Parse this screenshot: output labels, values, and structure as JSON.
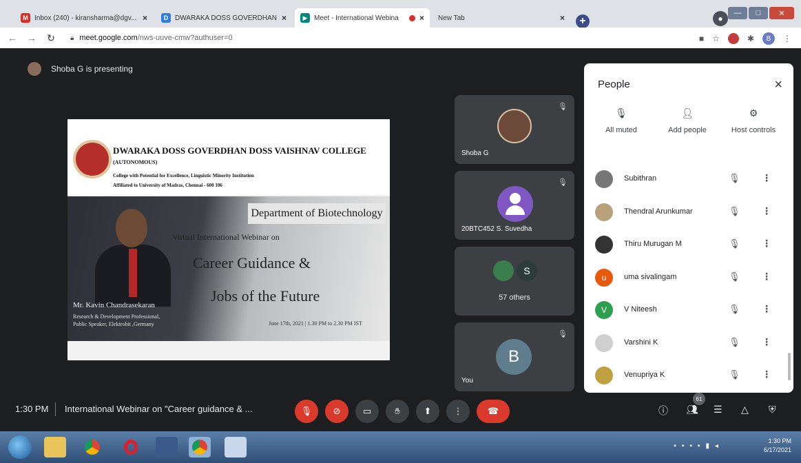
{
  "browser": {
    "tabs": [
      {
        "title": "Inbox (240) - kiransharma@dgv...",
        "close": "×",
        "favicon": "M",
        "favicon_color": "#d93025"
      },
      {
        "title": "DWARAKA DOSS GOVERDHAN D...",
        "close": "×",
        "favicon": "D",
        "favicon_color": "#2f7de1"
      },
      {
        "title": "Meet - International Webina",
        "close": "×",
        "favicon": "▶",
        "favicon_color": "#00897b"
      },
      {
        "title": "New Tab",
        "close": "×",
        "favicon": "",
        "favicon_color": ""
      }
    ],
    "new_tab": "+",
    "profile_letter": "",
    "url_host": "meet.google.com",
    "url_path": "/nws-uuve-cmw?authuser=0",
    "ext_letter": "B"
  },
  "meet": {
    "presenting_text": "Shoba G is presenting",
    "slide": {
      "college": "DWARAKA DOSS GOVERDHAN DOSS VAISHNAV COLLEGE",
      "autonomous": "(AUTONOMOUS)",
      "line1": "College with Potential for Excellence,  Linguistic Minority Institution",
      "line2": "Affiliated to University of Madras, Chennai - 600 106",
      "department": "Department of Biotechnology",
      "virtual": "Virtual International Webinar on",
      "title1": "Career Guidance &",
      "title2": "Jobs of the Future",
      "speaker": "Mr. Kavin Chandrasekaran",
      "speaker_d1": "Research & Development Professional,",
      "speaker_d2": "Public Speaker, Elektrobit ,Germany",
      "date": "June 17th, 2021 | 1.30 PM to 2.30 PM IST"
    },
    "tiles": [
      {
        "name": "Shoba G"
      },
      {
        "name": "20BTC452 S. Suvedha"
      },
      {
        "name": "57 others",
        "letter": "S"
      },
      {
        "name": "You",
        "letter": "B"
      }
    ],
    "people": {
      "title": "People",
      "close": "×",
      "actions": [
        {
          "label": "All muted",
          "icon": "mic-off-icon"
        },
        {
          "label": "Add people",
          "icon": "person-add-icon"
        },
        {
          "label": "Host controls",
          "icon": "host-controls-icon"
        }
      ],
      "list": [
        {
          "name": "Subithran",
          "initial": "",
          "color": "#777777"
        },
        {
          "name": "Thendral Arunkumar",
          "initial": "",
          "color": "#b8a07a"
        },
        {
          "name": "Thiru Murugan M",
          "initial": "",
          "color": "#333333"
        },
        {
          "name": "uma sivalingam",
          "initial": "u",
          "color": "#e8590c"
        },
        {
          "name": "V Niteesh",
          "initial": "V",
          "color": "#2e9e4f"
        },
        {
          "name": "Varshini K",
          "initial": "",
          "color": "#cfcfcf"
        },
        {
          "name": "Venupriya K",
          "initial": "",
          "color": "#c0a040"
        }
      ]
    },
    "bottom": {
      "time": "1:30 PM",
      "title": "International Webinar on \"Career guidance & ...",
      "participant_badge": "61"
    }
  },
  "taskbar": {
    "clock_time": "1:30 PM",
    "clock_date": "6/17/2021"
  },
  "colors": {
    "meet_bg": "#1d1e20",
    "tile_bg": "#3c4043",
    "danger": "#d93a2b"
  }
}
